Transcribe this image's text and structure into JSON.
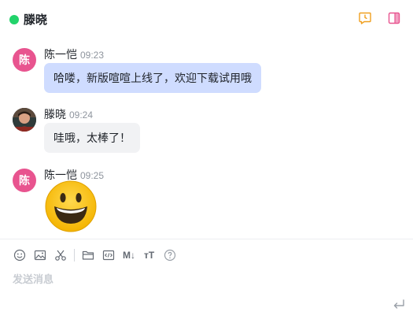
{
  "header": {
    "title": "滕晓",
    "status_color": "#22d36b",
    "icons": [
      "history-icon",
      "side-panel-icon"
    ]
  },
  "messages": [
    {
      "sender": "陈一恺",
      "time": "09:23",
      "avatar_text": "陈",
      "avatar_color": "#e8548f",
      "text": "哈喽，新版喧喧上线了，欢迎下载试用哦",
      "bubble": "mine"
    },
    {
      "sender": "滕晓",
      "time": "09:24",
      "avatar": "photo",
      "text": "哇哦，太棒了！",
      "bubble": "other"
    },
    {
      "sender": "陈一恺",
      "time": "09:25",
      "avatar_text": "陈",
      "avatar_color": "#e8548f",
      "emoji": "grinning-face-emoji"
    }
  ],
  "toolbar": {
    "icons": [
      "emoji-icon",
      "image-icon",
      "screenshot-scissors-icon",
      "folder-icon",
      "code-icon",
      "markdown-icon",
      "text-format-icon",
      "help-icon"
    ],
    "markdown_label": "M↓",
    "format_label": "ᴛT",
    "help_label": "?"
  },
  "composer": {
    "placeholder": "发送消息",
    "value": ""
  },
  "send": {
    "icon": "send-enter-icon"
  }
}
